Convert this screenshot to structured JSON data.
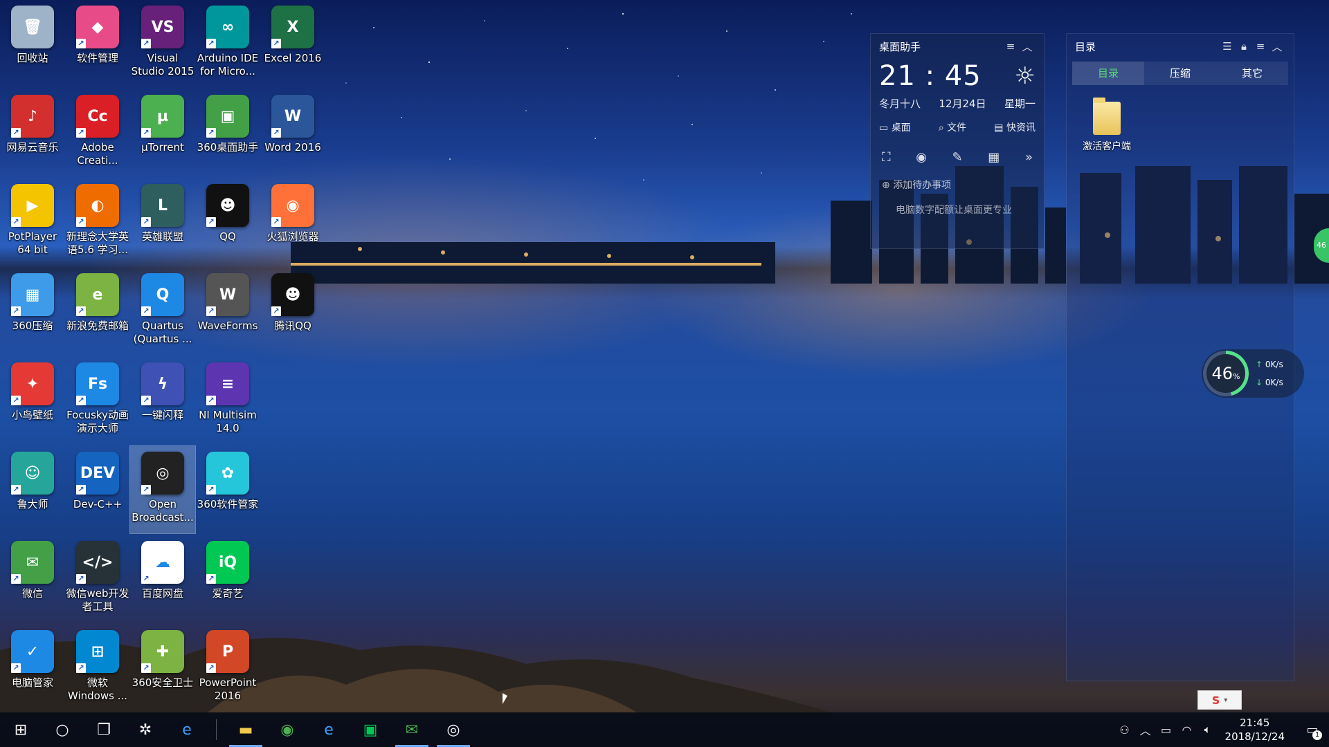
{
  "desktop_icons": [
    {
      "label": "回收站",
      "icon": "recycle-bin-icon",
      "glyph": "🗑",
      "color": "#9fb3c8"
    },
    {
      "label": "软件管理",
      "icon": "software-manager-icon",
      "glyph": "◆",
      "color": "#e84c88"
    },
    {
      "label": "Visual Studio 2015",
      "icon": "visual-studio-icon",
      "glyph": "VS",
      "color": "#68217a"
    },
    {
      "label": "Arduino IDE for Micro...",
      "icon": "arduino-icon",
      "glyph": "∞",
      "color": "#00979c"
    },
    {
      "label": "Excel 2016",
      "icon": "excel-icon",
      "glyph": "X",
      "color": "#1e7145"
    },
    {
      "label": "网易云音乐",
      "icon": "netease-music-icon",
      "glyph": "♪",
      "color": "#d32f2f"
    },
    {
      "label": "Adobe Creati...",
      "icon": "adobe-cc-icon",
      "glyph": "Cc",
      "color": "#da1f26"
    },
    {
      "label": "µTorrent",
      "icon": "utorrent-icon",
      "glyph": "µ",
      "color": "#4caf50"
    },
    {
      "label": "360桌面助手",
      "icon": "360-desktop-icon",
      "glyph": "▣",
      "color": "#43a047"
    },
    {
      "label": "Word 2016",
      "icon": "word-icon",
      "glyph": "W",
      "color": "#2b579a"
    },
    {
      "label": "PotPlayer 64 bit",
      "icon": "potplayer-icon",
      "glyph": "▶",
      "color": "#f5c400"
    },
    {
      "label": "新理念大学英语5.6 学习...",
      "icon": "english-learning-icon",
      "glyph": "◐",
      "color": "#ef6c00"
    },
    {
      "label": "英雄联盟",
      "icon": "league-icon",
      "glyph": "L",
      "color": "#2e5e5e"
    },
    {
      "label": "QQ",
      "icon": "qq-icon",
      "glyph": "☻",
      "color": "#111111"
    },
    {
      "label": "火狐浏览器",
      "icon": "firefox-icon",
      "glyph": "◉",
      "color": "#ff7139"
    },
    {
      "label": "360压缩",
      "icon": "360-zip-icon",
      "glyph": "▦",
      "color": "#3d9be9"
    },
    {
      "label": "新浪免费邮箱",
      "icon": "sina-mail-icon",
      "glyph": "e",
      "color": "#7cb342"
    },
    {
      "label": "Quartus (Quartus ...",
      "icon": "quartus-icon",
      "glyph": "Q",
      "color": "#1e88e5"
    },
    {
      "label": "WaveForms",
      "icon": "waveforms-icon",
      "glyph": "W",
      "color": "#555555"
    },
    {
      "label": "腾讯QQ",
      "icon": "tencent-qq-icon",
      "glyph": "☻",
      "color": "#111111"
    },
    {
      "label": "小鸟壁纸",
      "icon": "bird-wallpaper-icon",
      "glyph": "✦",
      "color": "#e53935"
    },
    {
      "label": "Focusky动画演示大师",
      "icon": "focusky-icon",
      "glyph": "Fs",
      "color": "#1e88e5"
    },
    {
      "label": "一键闪释",
      "icon": "flash-release-icon",
      "glyph": "ϟ",
      "color": "#3f51b5"
    },
    {
      "label": "NI Multisim 14.0",
      "icon": "multisim-icon",
      "glyph": "≡",
      "color": "#5e35b1"
    },
    {
      "label": "",
      "icon": "",
      "glyph": "",
      "color": ""
    },
    {
      "label": "鲁大师",
      "icon": "ludashi-icon",
      "glyph": "☺",
      "color": "#26a69a"
    },
    {
      "label": "Dev-C++",
      "icon": "dev-cpp-icon",
      "glyph": "DEV",
      "color": "#1565c0"
    },
    {
      "label": "Open Broadcast...",
      "icon": "obs-icon",
      "glyph": "◎",
      "color": "#222222"
    },
    {
      "label": "360软件管家",
      "icon": "360-software-icon",
      "glyph": "✿",
      "color": "#26c6da"
    },
    {
      "label": "",
      "icon": "",
      "glyph": "",
      "color": ""
    },
    {
      "label": "微信",
      "icon": "wechat-icon",
      "glyph": "✉",
      "color": "#43a047"
    },
    {
      "label": "微信web开发者工具",
      "icon": "wechat-devtools-icon",
      "glyph": "</>",
      "color": "#263238"
    },
    {
      "label": "百度网盘",
      "icon": "baidu-netdisk-icon",
      "glyph": "☁",
      "color": "#ffffff"
    },
    {
      "label": "爱奇艺",
      "icon": "iqiyi-icon",
      "glyph": "iQ",
      "color": "#00c853"
    },
    {
      "label": "",
      "icon": "",
      "glyph": "",
      "color": ""
    },
    {
      "label": "电脑管家",
      "icon": "pc-manager-icon",
      "glyph": "✓",
      "color": "#1e88e5"
    },
    {
      "label": "微软 Windows ...",
      "icon": "windows-icon",
      "glyph": "⊞",
      "color": "#0288d1"
    },
    {
      "label": "360安全卫士",
      "icon": "360-safe-icon",
      "glyph": "✚",
      "color": "#7cb342"
    },
    {
      "label": "PowerPoint 2016",
      "icon": "powerpoint-icon",
      "glyph": "P",
      "color": "#d24726"
    }
  ],
  "assistant": {
    "title": "桌面助手",
    "time": "21 : 45",
    "lunar": "冬月十八",
    "date": "12月24日",
    "weekday": "星期一",
    "quick": [
      "桌面",
      "文件",
      "快资讯"
    ],
    "todo": "添加待办事项",
    "notice": "电脑数字配额让桌面更专业"
  },
  "directory": {
    "title": "目录",
    "tabs": [
      "目录",
      "压缩",
      "其它"
    ],
    "item": "激活客户端"
  },
  "gauge": {
    "percent": "46",
    "unit": "%",
    "up": "0K/s",
    "down": "0K/s"
  },
  "edge_badge": "46",
  "taskbar": {
    "time": "21:45",
    "date": "2018/12/24",
    "notif_count": "1"
  }
}
